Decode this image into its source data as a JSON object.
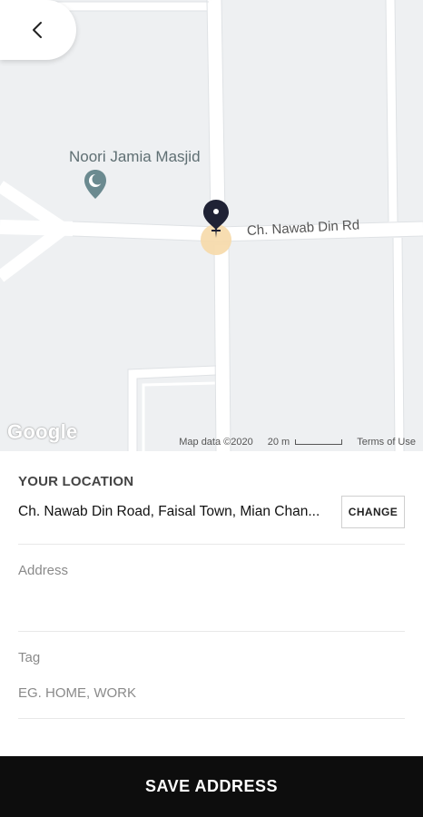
{
  "map": {
    "poi_label": "Noori Jamia Masjid",
    "road_label": "Ch. Nawab Din Rd",
    "google_logo": "Google",
    "map_data": "Map data ©2020",
    "scale_label": "20 m",
    "terms": "Terms of Use"
  },
  "location": {
    "section_title": "YOUR LOCATION",
    "address_text": "Ch. Nawab Din Road, Faisal Town, Mian Chan...",
    "change_label": "CHANGE"
  },
  "form": {
    "address_label": "Address",
    "address_value": "",
    "tag_label": "Tag",
    "tag_placeholder": "EG. HOME, WORK"
  },
  "footer": {
    "save_label": "SAVE ADDRESS"
  },
  "colors": {
    "map_bg": "#eef0f2",
    "road": "#ffffff",
    "pin_dark": "#1f2235",
    "pin_halo": "#f6d9a8",
    "button_bg": "#0d0d0d"
  }
}
